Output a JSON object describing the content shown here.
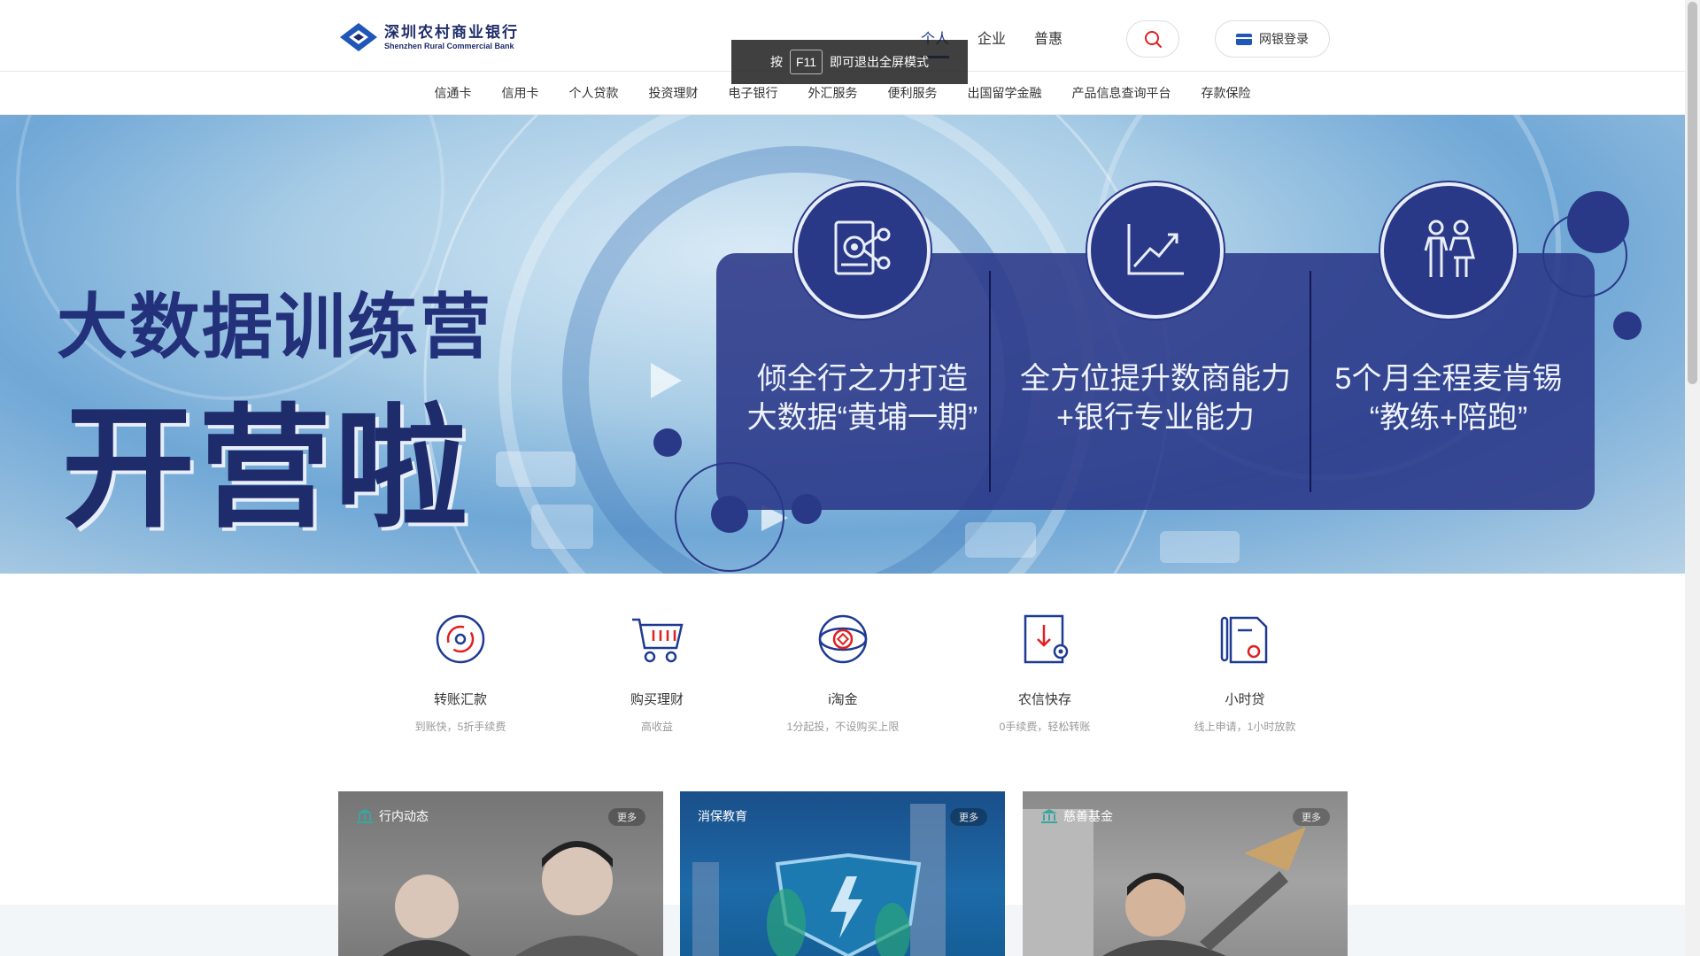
{
  "header": {
    "logo_cn": "深圳农村商业银行",
    "logo_en": "Shenzhen Rural Commercial Bank",
    "segments": [
      "个人",
      "企业",
      "普惠"
    ],
    "active_segment": "个人",
    "login_label": "网银登录"
  },
  "fullscreen_tip": {
    "prefix": "按",
    "key": "F11",
    "suffix": "即可退出全屏模式"
  },
  "sub_nav": [
    "信通卡",
    "信用卡",
    "个人贷款",
    "投资理财",
    "电子银行",
    "外汇服务",
    "便利服务",
    "出国留学金融",
    "产品信息查询平台",
    "存款保险"
  ],
  "banner": {
    "title_line1": "大数据训练营",
    "title_line2": "开营啦",
    "features": [
      {
        "icon": "document-analytics-icon",
        "line1": "倾全行之力打造",
        "line2": "大数据“黄埔一期”"
      },
      {
        "icon": "growth-chart-icon",
        "line1": "全方位提升数商能力",
        "line2": "+银行专业能力"
      },
      {
        "icon": "people-icon",
        "line1": "5个月全程麦肯锡",
        "line2": "“教练+陪跑”"
      }
    ]
  },
  "services": [
    {
      "icon": "transfer-icon",
      "title": "转账汇款",
      "desc": "到账快，5折手续费"
    },
    {
      "icon": "shopping-cart-icon",
      "title": "购买理财",
      "desc": "高收益"
    },
    {
      "icon": "gold-icon",
      "title": "i淘金",
      "desc": "1分起投，不设购买上限"
    },
    {
      "icon": "deposit-icon",
      "title": "农信快存",
      "desc": "0手续费，轻松转账"
    },
    {
      "icon": "loan-icon",
      "title": "小时贷",
      "desc": "线上申请，1小时放款"
    }
  ],
  "cards": [
    {
      "title": "行内动态",
      "more": "更多",
      "icon": "bank-icon"
    },
    {
      "title": "消保教育",
      "more": "更多",
      "icon": ""
    },
    {
      "title": "慈善基金",
      "more": "更多",
      "icon": "bank-icon"
    }
  ],
  "colors": {
    "brand": "#1f3a93",
    "panel": "#2a3888",
    "accent_red": "#e02020"
  }
}
